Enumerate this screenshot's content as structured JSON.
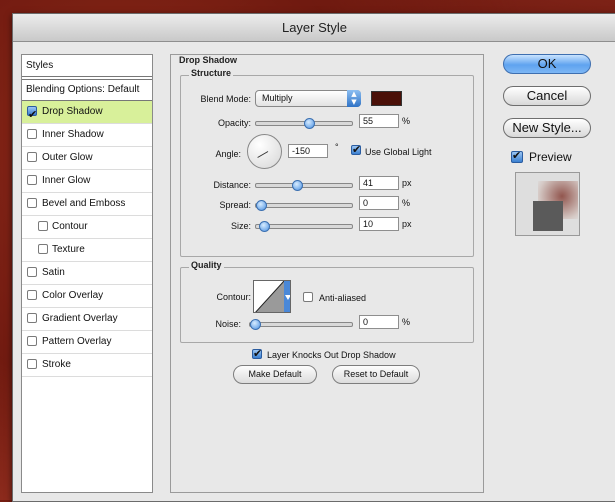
{
  "window": {
    "title": "Layer Style"
  },
  "styles_panel": {
    "header": "Styles",
    "blending_options": "Blending Options: Default",
    "items": [
      {
        "label": "Drop Shadow",
        "checked": true,
        "indent": false,
        "active": true
      },
      {
        "label": "Inner Shadow",
        "checked": false,
        "indent": false,
        "active": false
      },
      {
        "label": "Outer Glow",
        "checked": false,
        "indent": false,
        "active": false
      },
      {
        "label": "Inner Glow",
        "checked": false,
        "indent": false,
        "active": false
      },
      {
        "label": "Bevel and Emboss",
        "checked": false,
        "indent": false,
        "active": false
      },
      {
        "label": "Contour",
        "checked": false,
        "indent": true,
        "active": false
      },
      {
        "label": "Texture",
        "checked": false,
        "indent": true,
        "active": false
      },
      {
        "label": "Satin",
        "checked": false,
        "indent": false,
        "active": false
      },
      {
        "label": "Color Overlay",
        "checked": false,
        "indent": false,
        "active": false
      },
      {
        "label": "Gradient Overlay",
        "checked": false,
        "indent": false,
        "active": false
      },
      {
        "label": "Pattern Overlay",
        "checked": false,
        "indent": false,
        "active": false
      },
      {
        "label": "Stroke",
        "checked": false,
        "indent": false,
        "active": false
      }
    ]
  },
  "drop_shadow": {
    "section_title": "Drop Shadow",
    "structure": {
      "title": "Structure",
      "blend_mode_label": "Blend Mode:",
      "blend_mode_value": "Multiply",
      "shadow_color": "#4a1008",
      "opacity_label": "Opacity:",
      "opacity_value": "55",
      "opacity_unit": "%",
      "opacity_level": 0.55,
      "angle_label": "Angle:",
      "angle_value": "-150",
      "angle_unit": "°",
      "use_global_light_label": "Use Global Light",
      "use_global_light": true,
      "distance_label": "Distance:",
      "distance_value": "41",
      "distance_unit": "px",
      "distance_level": 0.41,
      "spread_label": "Spread:",
      "spread_value": "0",
      "spread_unit": "%",
      "spread_level": 0,
      "size_label": "Size:",
      "size_value": "10",
      "size_unit": "px",
      "size_level": 0.04
    },
    "quality": {
      "title": "Quality",
      "contour_label": "Contour:",
      "anti_aliased_label": "Anti-aliased",
      "anti_aliased": false,
      "noise_label": "Noise:",
      "noise_value": "0",
      "noise_unit": "%",
      "noise_level": 0
    },
    "knocks_out_label": "Layer Knocks Out Drop Shadow",
    "knocks_out": true,
    "make_default_label": "Make Default",
    "reset_default_label": "Reset to Default"
  },
  "buttons": {
    "ok": "OK",
    "cancel": "Cancel",
    "new_style": "New Style...",
    "preview_label": "Preview",
    "preview_checked": true
  }
}
